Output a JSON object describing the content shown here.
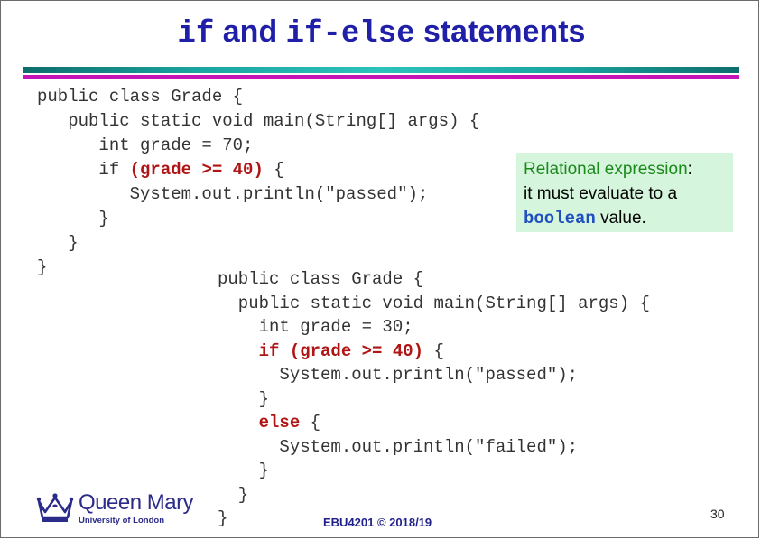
{
  "slide": {
    "title": {
      "kw_if": "if",
      "and": " and ",
      "kw_if_else": "if-else",
      "statements": " statements"
    },
    "code_block_1": {
      "lines": [
        {
          "text": "public class Grade {"
        },
        {
          "text": "   public static void main(String[] args) {"
        },
        {
          "text": "      int grade = 70;"
        },
        {
          "pre": "      if ",
          "hl": "(grade >= 40)",
          "post": " {"
        },
        {
          "text": "         System.out.println(\"passed\");"
        },
        {
          "text": "      }"
        },
        {
          "text": "   }"
        },
        {
          "text": "}"
        }
      ]
    },
    "note": {
      "part1": "Relational expression",
      "part2": ":",
      "part3": "it must evaluate to a",
      "part4": "boolean",
      "part5": " value."
    },
    "code_block_2": {
      "lines": [
        {
          "text": "public class Grade {"
        },
        {
          "text": "  public static void main(String[] args) {"
        },
        {
          "text": "    int grade = 30;"
        },
        {
          "pre": "    ",
          "hl": "if (grade >= 40)",
          "post": " {"
        },
        {
          "text": "      System.out.println(\"passed\");"
        },
        {
          "text": "    }"
        },
        {
          "pre": "    ",
          "hl": "else",
          "post": " {"
        },
        {
          "text": "      System.out.println(\"failed\");"
        },
        {
          "text": "    }"
        },
        {
          "text": "  }"
        },
        {
          "text": "}"
        }
      ]
    },
    "logo": {
      "name": "Queen Mary",
      "subtitle": "University of London"
    },
    "footer": "EBU4201 © 2018/19",
    "page_number": "30",
    "colors": {
      "title": "#1f1fa8",
      "keyword_highlight": "#b01515",
      "note_background": "#d6f5dd",
      "note_highlight": "#1b8a1b",
      "rule_teal": "#1aa5a2",
      "rule_purple": "#c414b6"
    }
  }
}
